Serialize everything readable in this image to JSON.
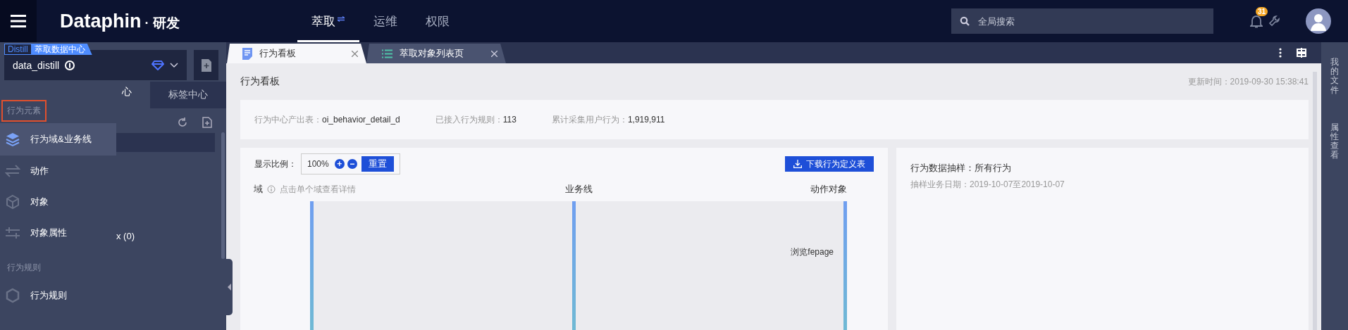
{
  "header": {
    "brand": "Dataphin",
    "separator": "·",
    "module": "研发",
    "nav": [
      {
        "label": "萃取",
        "selected": true
      },
      {
        "label": "运维",
        "selected": false
      },
      {
        "label": "权限",
        "selected": false
      }
    ],
    "search": {
      "placeholder": "全局搜索"
    },
    "notification_count": "31"
  },
  "workspace": {
    "tag": "Distill",
    "tag_label": "萃取数据中心",
    "name": "data_distill"
  },
  "sidebar_tabs": [
    {
      "label": "心",
      "selected": true
    },
    {
      "label": "标签中心",
      "selected": false
    }
  ],
  "sidebar_row_text": "x (0)",
  "element_menu": [
    {
      "title": "行为元素",
      "focused": true,
      "items": [
        {
          "label": "行为域&业务线",
          "kind": "layers",
          "selected": true
        },
        {
          "label": "动作",
          "kind": "arrows",
          "selected": false
        },
        {
          "label": "对象",
          "kind": "cube",
          "selected": false
        },
        {
          "label": "对象属性",
          "kind": "sliders",
          "selected": false
        }
      ]
    },
    {
      "title": "行为规则",
      "focused": false,
      "items": [
        {
          "label": "行为规则",
          "kind": "rule",
          "selected": false
        }
      ]
    }
  ],
  "tabs": [
    {
      "label": "行为看板",
      "selected": true
    },
    {
      "label": "萃取对象列表页",
      "selected": false
    }
  ],
  "page": {
    "title": "行为看板",
    "updated": "更新时间：2019-09-30 15:38:41",
    "stats": [
      {
        "label": "行为中心产出表：",
        "value": "oi_behavior_detail_d"
      },
      {
        "label": "已接入行为规则：",
        "value": "113"
      },
      {
        "label": "累计采集用户行为：",
        "value": "1,919,911"
      }
    ],
    "zoom": {
      "label": "显示比例：",
      "value": "100%",
      "plus": "+",
      "minus": "−",
      "reset": "重置"
    },
    "download": "下载行为定义表",
    "columns": [
      {
        "label": "域",
        "hint": "点击单个域查看详情"
      },
      {
        "label": "业务线"
      },
      {
        "label": "动作对象"
      }
    ],
    "node": "浏览fepage",
    "sample": {
      "title": "行为数据抽样：所有行为",
      "date": "抽样业务日期：2019-10-07至2019-10-07"
    }
  },
  "right_rail": [
    "我的文件",
    "属性查看"
  ]
}
